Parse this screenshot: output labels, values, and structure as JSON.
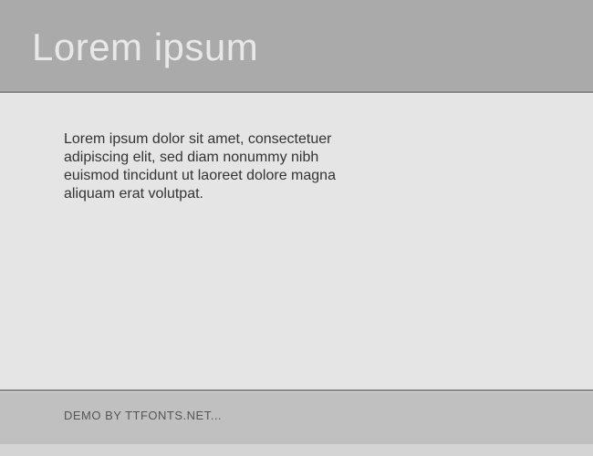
{
  "header": {
    "title": "Lorem ipsum"
  },
  "content": {
    "body_text": "Lorem ipsum dolor sit amet, consectetuer adipiscing elit, sed diam nonummy nibh euismod tincidunt ut laoreet dolore magna aliquam erat volutpat."
  },
  "footer": {
    "text": "DEMO BY TTFONTS.NET..."
  }
}
